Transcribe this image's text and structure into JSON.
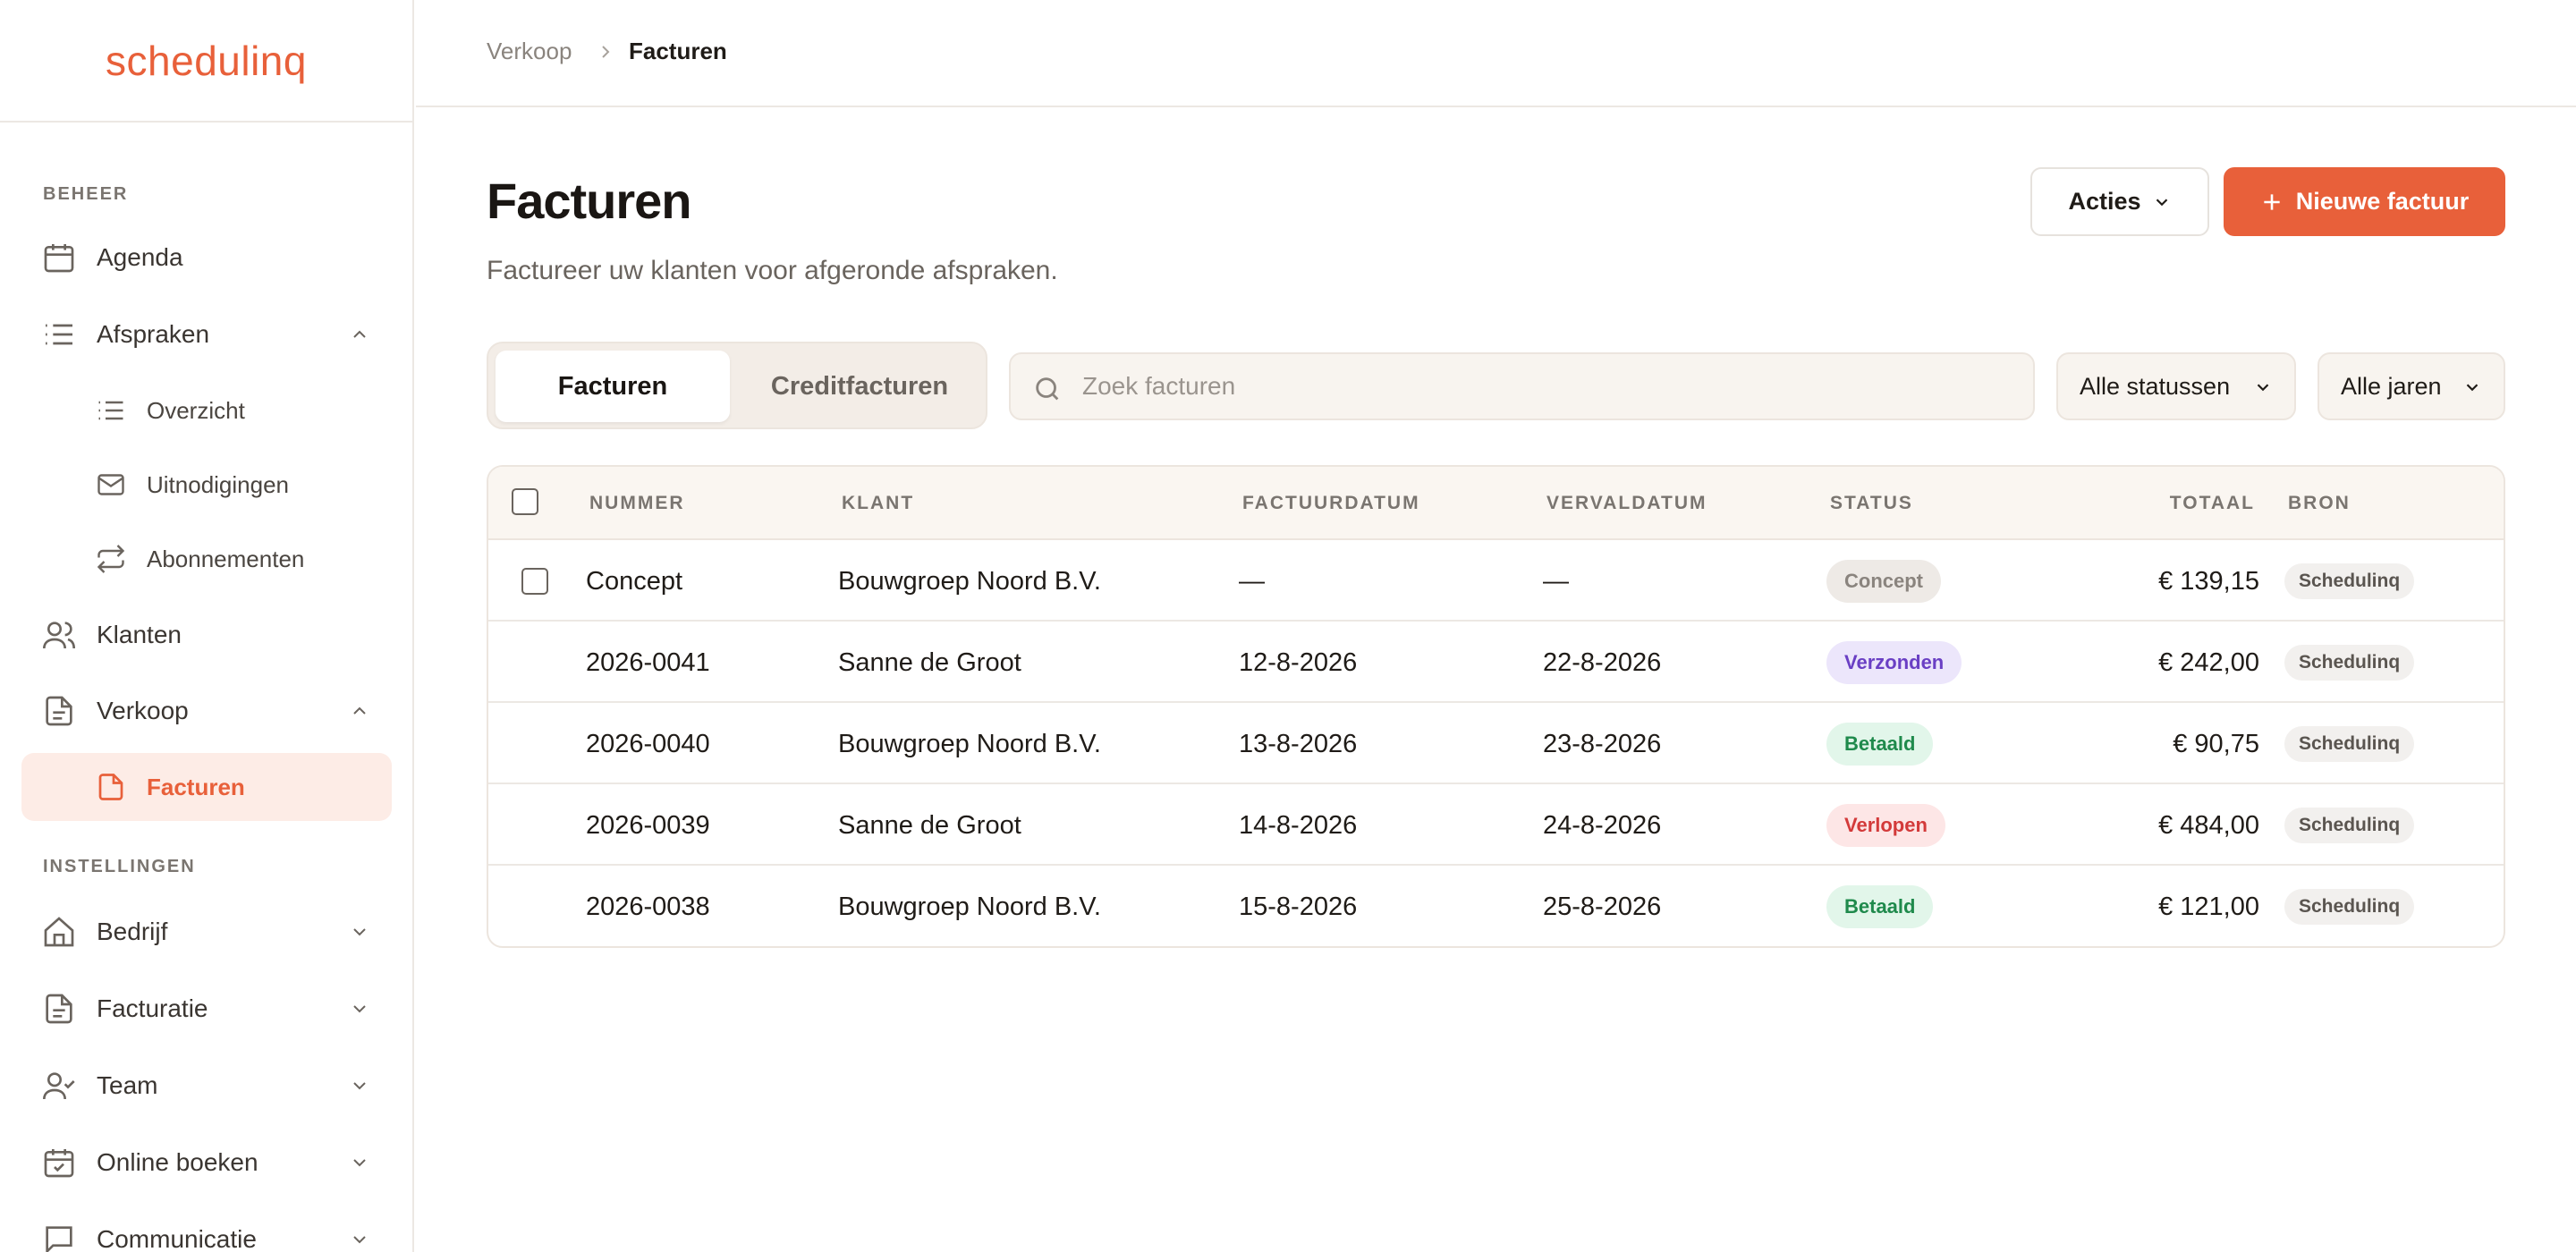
{
  "brand": {
    "logo_text": "schedulinq",
    "color": "#e8603a"
  },
  "sidebar": {
    "section_beheer": "BEHEER",
    "section_instellingen": "INSTELLINGEN",
    "items": [
      {
        "label": "Agenda",
        "icon": "calendar-icon"
      },
      {
        "label": "Afspraken",
        "icon": "list-icon",
        "expanded": true
      },
      {
        "label": "Overzicht",
        "icon": "list-icon"
      },
      {
        "label": "Uitnodigingen",
        "icon": "mail-icon"
      },
      {
        "label": "Abonnementen",
        "icon": "repeat-icon"
      },
      {
        "label": "Klanten",
        "icon": "users-icon"
      },
      {
        "label": "Verkoop",
        "icon": "document-icon",
        "expanded": true
      },
      {
        "label": "Facturen",
        "icon": "document-icon",
        "active": true
      },
      {
        "label": "Bedrijf",
        "icon": "home-icon"
      },
      {
        "label": "Facturatie",
        "icon": "document-icon"
      },
      {
        "label": "Team",
        "icon": "user-check-icon"
      },
      {
        "label": "Online boeken",
        "icon": "calendar-check-icon"
      },
      {
        "label": "Communicatie",
        "icon": "chat-icon"
      }
    ]
  },
  "breadcrumb": {
    "parent": "Verkoop",
    "current": "Facturen"
  },
  "header": {
    "title": "Facturen",
    "subtitle": "Factureer uw klanten voor afgeronde afspraken.",
    "actions_label": "Acties",
    "new_invoice_label": "Nieuwe factuur"
  },
  "tabs": [
    {
      "label": "Facturen",
      "active": true
    },
    {
      "label": "Creditfacturen",
      "active": false
    }
  ],
  "search": {
    "placeholder": "Zoek facturen",
    "value": ""
  },
  "filters": {
    "status": "Alle statussen",
    "year": "Alle jaren"
  },
  "table": {
    "columns": [
      "NUMMER",
      "KLANT",
      "FACTUURDATUM",
      "VERVALDATUM",
      "STATUS",
      "TOTAAL",
      "BRON"
    ],
    "rows": [
      {
        "number": "Concept",
        "client": "Bouwgroep Noord B.V.",
        "invoice_date": "—",
        "due_date": "—",
        "status": "Concept",
        "total": "€ 139,15",
        "source": "Schedulinq"
      },
      {
        "number": "2026-0041",
        "client": "Sanne de Groot",
        "invoice_date": "12-8-2026",
        "due_date": "22-8-2026",
        "status": "Verzonden",
        "total": "€ 242,00",
        "source": "Schedulinq"
      },
      {
        "number": "2026-0040",
        "client": "Bouwgroep Noord B.V.",
        "invoice_date": "13-8-2026",
        "due_date": "23-8-2026",
        "status": "Betaald",
        "total": "€ 90,75",
        "source": "Schedulinq"
      },
      {
        "number": "2026-0039",
        "client": "Sanne de Groot",
        "invoice_date": "14-8-2026",
        "due_date": "24-8-2026",
        "status": "Verlopen",
        "total": "€ 484,00",
        "source": "Schedulinq"
      },
      {
        "number": "2026-0038",
        "client": "Bouwgroep Noord B.V.",
        "invoice_date": "15-8-2026",
        "due_date": "25-8-2026",
        "status": "Betaald",
        "total": "€ 121,00",
        "source": "Schedulinq"
      }
    ]
  },
  "status_colors": {
    "Concept": {
      "bg": "#eeeae6",
      "fg": "#8a847e"
    },
    "Verzonden": {
      "bg": "#ece6fb",
      "fg": "#6a3fc4"
    },
    "Betaald": {
      "bg": "#e2f6ea",
      "fg": "#1f8a4c"
    },
    "Verlopen": {
      "bg": "#fde6e6",
      "fg": "#d33a3a"
    }
  }
}
